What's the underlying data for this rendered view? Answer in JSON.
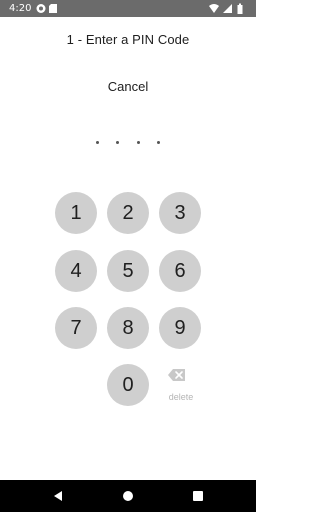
{
  "status_bar": {
    "time": "4:20",
    "left_icons": [
      "notification-icon",
      "sd-card-icon"
    ],
    "right_icons": [
      "wifi-icon",
      "signal-icon",
      "battery-icon"
    ]
  },
  "header": {
    "title": "1 - Enter a PIN Code"
  },
  "actions": {
    "cancel_label": "Cancel"
  },
  "pin": {
    "length": 4,
    "entered": 0
  },
  "keypad": {
    "keys": [
      "1",
      "2",
      "3",
      "4",
      "5",
      "6",
      "7",
      "8",
      "9",
      "0"
    ],
    "delete_label": "delete"
  },
  "nav_bar": {
    "buttons": [
      "back-icon",
      "home-icon",
      "recents-icon"
    ]
  }
}
